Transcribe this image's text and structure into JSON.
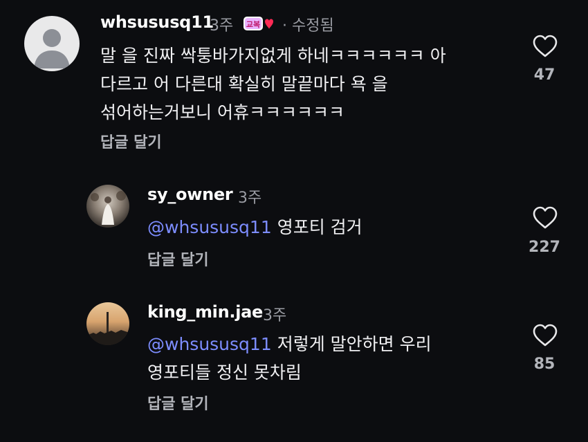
{
  "comments": [
    {
      "username": "whsususq11",
      "time": "3주",
      "badge_text": "교복",
      "edited": "· 수정됨",
      "lines": [
        "말 을 진짜 싹퉁바가지없게 하네ㅋㅋㅋㅋㅋㅋ 아",
        "다르고 어 다른대 확실히 말끝마다 욕 을",
        "섞어하는거보니 어휴ㅋㅋㅋㅋㅋㅋ"
      ],
      "reply_label": "답글 달기",
      "like_count": "47",
      "like_icon": "heart-outline-icon"
    },
    {
      "username": "sy_owner",
      "time": "3주",
      "mention": "@whsususq11",
      "lines": [
        "영포티 검거"
      ],
      "reply_label": "답글 달기",
      "like_count": "227",
      "like_icon": "heart-outline-icon"
    },
    {
      "username": "king_min.jae",
      "time": "3주",
      "mention": "@whsususq11",
      "lines": [
        "저렇게 말안하면 우리",
        "영포티들 정신 못차림"
      ],
      "reply_label": "답글 달기",
      "like_count": "85",
      "like_icon": "heart-outline-icon"
    }
  ],
  "colors": {
    "background": "#0c0d10",
    "mention": "#7d8dff",
    "muted": "#9a9ca3"
  }
}
